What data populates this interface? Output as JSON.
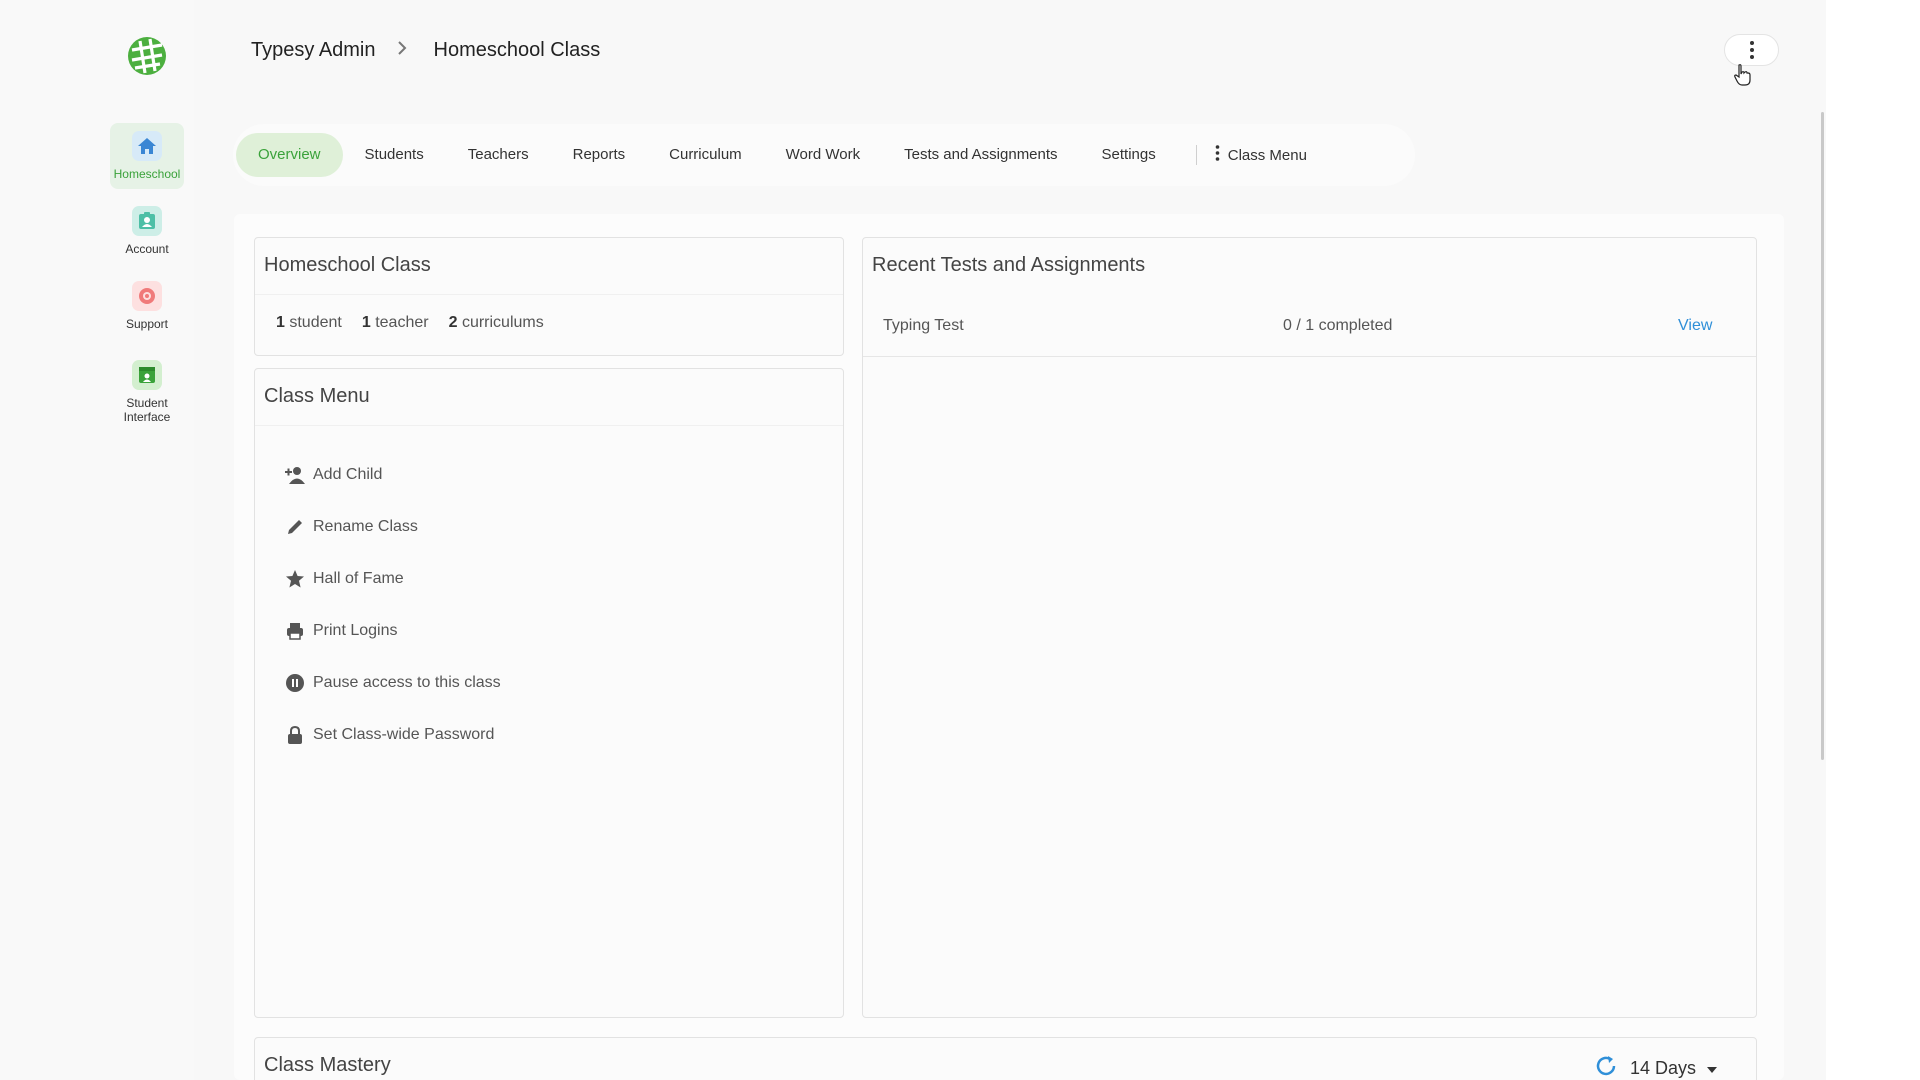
{
  "breadcrumb": {
    "root": "Typesy Admin",
    "current": "Homeschool Class"
  },
  "sidebar": {
    "items": [
      {
        "label": "Homeschool",
        "icon": "home-icon",
        "active": true
      },
      {
        "label": "Account",
        "icon": "account-icon",
        "active": false
      },
      {
        "label": "Support",
        "icon": "support-icon",
        "active": false
      },
      {
        "label": "Student Interface",
        "icon": "student-interface-icon",
        "active": false
      }
    ]
  },
  "tabs": {
    "items": [
      "Overview",
      "Students",
      "Teachers",
      "Reports",
      "Curriculum",
      "Word Work",
      "Tests and Assignments",
      "Settings"
    ],
    "active": "Overview",
    "class_menu": "Class Menu"
  },
  "class_card": {
    "title": "Homeschool Class",
    "stats": [
      {
        "count": "1",
        "label": "student"
      },
      {
        "count": "1",
        "label": "teacher"
      },
      {
        "count": "2",
        "label": "curriculums"
      }
    ]
  },
  "class_menu_card": {
    "title": "Class Menu",
    "items": [
      {
        "label": "Add Child",
        "icon": "add-person-icon"
      },
      {
        "label": "Rename Class",
        "icon": "pencil-icon"
      },
      {
        "label": "Hall of Fame",
        "icon": "star-icon"
      },
      {
        "label": "Print Logins",
        "icon": "printer-icon"
      },
      {
        "label": "Pause access to this class",
        "icon": "pause-icon"
      },
      {
        "label": "Set Class-wide Password",
        "icon": "lock-icon"
      }
    ]
  },
  "recent_card": {
    "title": "Recent Tests and Assignments",
    "rows": [
      {
        "name": "Typing Test",
        "progress": "0 / 1 completed",
        "action": "View"
      }
    ]
  },
  "mastery_card": {
    "title": "Class Mastery",
    "range": "14 Days"
  },
  "colors": {
    "accent": "#3aa23a",
    "link": "#2f8fd8",
    "active_tab_bg": "#dff0d8"
  }
}
